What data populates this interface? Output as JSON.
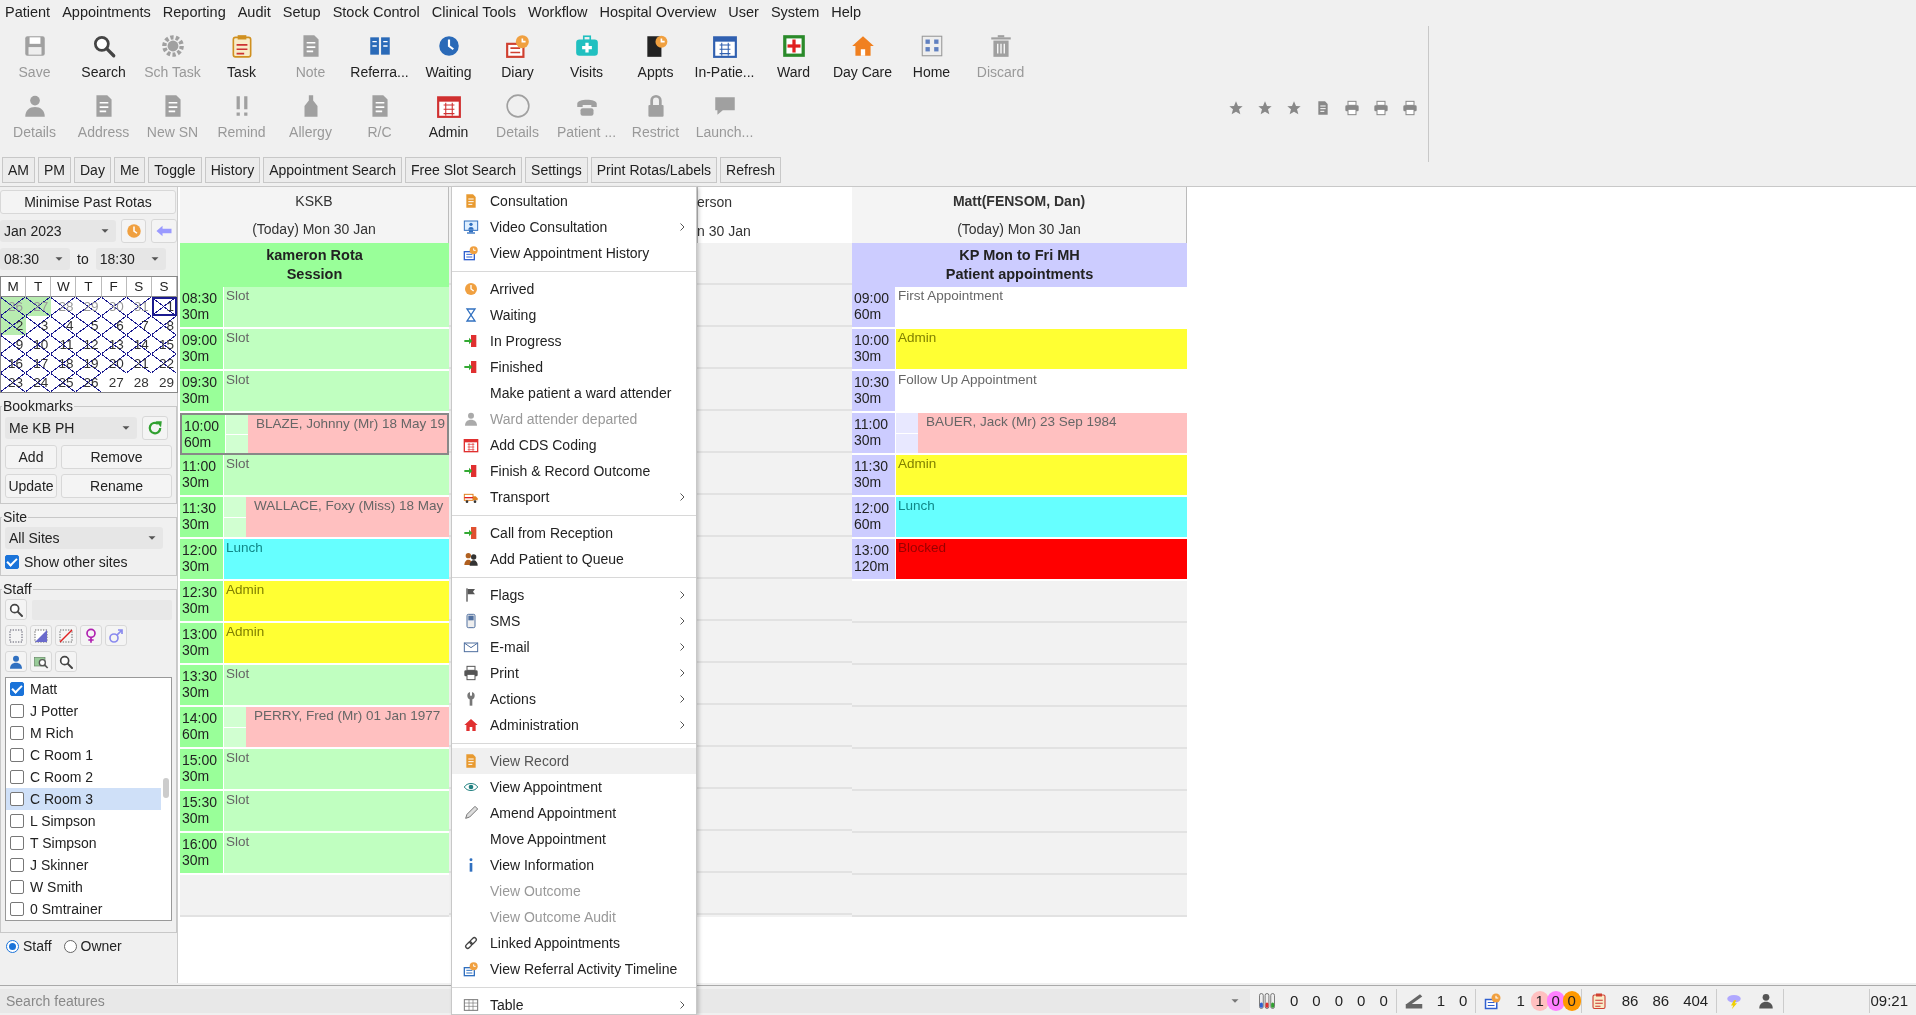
{
  "menu_bar": [
    "Patient",
    "Appointments",
    "Reporting",
    "Audit",
    "Setup",
    "Stock Control",
    "Clinical Tools",
    "Workflow",
    "Hospital Overview",
    "User",
    "System",
    "Help"
  ],
  "toolbar": {
    "rows": [
      [
        {
          "label": "Save",
          "disabled": true
        },
        {
          "label": "Search",
          "disabled": false
        },
        {
          "label": "Sch Task",
          "disabled": true
        },
        {
          "label": "Task",
          "disabled": false
        },
        {
          "label": "Note",
          "disabled": true
        },
        {
          "label": "Referra...",
          "disabled": false
        },
        {
          "label": "Waiting",
          "disabled": false
        },
        {
          "label": "Diary",
          "disabled": false
        },
        {
          "label": "Visits",
          "disabled": false
        },
        {
          "label": "Appts",
          "disabled": false
        },
        {
          "label": "In-Patie...",
          "disabled": false
        },
        {
          "label": "Ward",
          "disabled": false
        },
        {
          "label": "Day Care",
          "disabled": false
        },
        {
          "label": "Home",
          "disabled": false
        },
        {
          "label": "Discard",
          "disabled": true
        }
      ],
      [
        {
          "label": "Details",
          "disabled": true
        },
        {
          "label": "Address",
          "disabled": true
        },
        {
          "label": "New SN",
          "disabled": true
        },
        {
          "label": "Remind",
          "disabled": true
        },
        {
          "label": "Allergy",
          "disabled": true
        },
        {
          "label": "R/C",
          "disabled": true
        },
        {
          "label": "Admin",
          "disabled": false
        },
        {
          "label": "Details",
          "disabled": true
        },
        {
          "label": "Patient ...",
          "disabled": true
        },
        {
          "label": "Restrict",
          "disabled": true
        },
        {
          "label": "Launch...",
          "disabled": true
        }
      ]
    ]
  },
  "view_buttons": [
    "AM",
    "PM",
    "Day",
    "Me",
    "Toggle",
    "History",
    "Appointment Search",
    "Free Slot Search",
    "Settings",
    "Print Rotas/Labels",
    "Refresh"
  ],
  "left_panel": {
    "minimise_button": "Minimise Past Rotas",
    "month": "Jan 2023",
    "time_from": "08:30",
    "time_to_label": "to",
    "time_to": "18:30",
    "weekdays": [
      "M",
      "T",
      "W",
      "T",
      "F",
      "S",
      "S"
    ],
    "weeks": [
      [
        {
          "day": "26",
          "other_month": true,
          "crossed": true,
          "booked": true,
          "selected": false
        },
        {
          "day": "27",
          "other_month": true,
          "crossed": true,
          "booked": true,
          "selected": false
        },
        {
          "day": "28",
          "other_month": true,
          "crossed": true,
          "booked": false,
          "selected": false
        },
        {
          "day": "29",
          "other_month": true,
          "crossed": true,
          "booked": false,
          "selected": false
        },
        {
          "day": "30",
          "other_month": true,
          "crossed": true,
          "booked": false,
          "selected": false
        },
        {
          "day": "31",
          "other_month": true,
          "crossed": true,
          "booked": false,
          "selected": false
        },
        {
          "day": "1",
          "other_month": false,
          "crossed": true,
          "booked": false,
          "selected": true
        }
      ],
      [
        {
          "day": "2",
          "other_month": false,
          "crossed": true,
          "booked": true,
          "selected": false
        },
        {
          "day": "3",
          "other_month": false,
          "crossed": true,
          "booked": false,
          "selected": false
        },
        {
          "day": "4",
          "other_month": false,
          "crossed": true,
          "booked": false,
          "selected": false
        },
        {
          "day": "5",
          "other_month": false,
          "crossed": true,
          "booked": false,
          "selected": false
        },
        {
          "day": "6",
          "other_month": false,
          "crossed": true,
          "booked": false,
          "selected": false
        },
        {
          "day": "7",
          "other_month": false,
          "crossed": true,
          "booked": false,
          "selected": false
        },
        {
          "day": "8",
          "other_month": false,
          "crossed": true,
          "booked": false,
          "selected": false
        }
      ],
      [
        {
          "day": "9",
          "other_month": false,
          "crossed": true,
          "booked": false,
          "selected": false
        },
        {
          "day": "10",
          "other_month": false,
          "crossed": true,
          "booked": false,
          "selected": false
        },
        {
          "day": "11",
          "other_month": false,
          "crossed": true,
          "booked": false,
          "selected": false
        },
        {
          "day": "12",
          "other_month": false,
          "crossed": true,
          "booked": false,
          "selected": false
        },
        {
          "day": "13",
          "other_month": false,
          "crossed": true,
          "booked": false,
          "selected": false
        },
        {
          "day": "14",
          "other_month": false,
          "crossed": true,
          "booked": false,
          "selected": false
        },
        {
          "day": "15",
          "other_month": false,
          "crossed": true,
          "booked": false,
          "selected": false
        }
      ],
      [
        {
          "day": "16",
          "other_month": false,
          "crossed": true,
          "booked": false,
          "selected": false
        },
        {
          "day": "17",
          "other_month": false,
          "crossed": true,
          "booked": false,
          "selected": false
        },
        {
          "day": "18",
          "other_month": false,
          "crossed": true,
          "booked": false,
          "selected": false
        },
        {
          "day": "19",
          "other_month": false,
          "crossed": true,
          "booked": false,
          "selected": false
        },
        {
          "day": "20",
          "other_month": false,
          "crossed": true,
          "booked": false,
          "selected": false
        },
        {
          "day": "21",
          "other_month": false,
          "crossed": true,
          "booked": false,
          "selected": false
        },
        {
          "day": "22",
          "other_month": false,
          "crossed": true,
          "booked": false,
          "selected": false
        }
      ],
      [
        {
          "day": "23",
          "other_month": false,
          "crossed": true,
          "booked": false,
          "selected": false
        },
        {
          "day": "24",
          "other_month": false,
          "crossed": true,
          "booked": false,
          "selected": false
        },
        {
          "day": "25",
          "other_month": false,
          "crossed": true,
          "booked": false,
          "selected": false
        },
        {
          "day": "26",
          "other_month": false,
          "crossed": true,
          "booked": false,
          "selected": false
        },
        {
          "day": "27",
          "other_month": false,
          "crossed": false,
          "booked": false,
          "selected": false
        },
        {
          "day": "28",
          "other_month": false,
          "crossed": false,
          "booked": false,
          "selected": false
        },
        {
          "day": "29",
          "other_month": false,
          "crossed": false,
          "booked": false,
          "selected": false
        }
      ]
    ],
    "bookmarks": {
      "title": "Bookmarks",
      "value": "Me KB PH",
      "buttons": [
        "Add",
        "Remove",
        "Update",
        "Rename"
      ]
    },
    "site": {
      "title": "Site",
      "value": "All Sites",
      "checkbox": {
        "label": "Show other sites",
        "checked": true
      }
    },
    "staff": {
      "title": "Staff",
      "items": [
        {
          "name": "Matt",
          "checked": true,
          "selected": false
        },
        {
          "name": "J Potter",
          "checked": false,
          "selected": false
        },
        {
          "name": "M Rich",
          "checked": false,
          "selected": false
        },
        {
          "name": "C Room 1",
          "checked": false,
          "selected": false
        },
        {
          "name": "C Room 2",
          "checked": false,
          "selected": false
        },
        {
          "name": "C Room 3",
          "checked": false,
          "selected": true
        },
        {
          "name": "L Simpson",
          "checked": false,
          "selected": false
        },
        {
          "name": "T Simpson",
          "checked": false,
          "selected": false
        },
        {
          "name": "J Skinner",
          "checked": false,
          "selected": false
        },
        {
          "name": "W Smith",
          "checked": false,
          "selected": false
        },
        {
          "name": "0 Smtrainer",
          "checked": false,
          "selected": false
        }
      ]
    },
    "filter": [
      {
        "label": "Staff",
        "selected": true
      },
      {
        "label": "Owner",
        "selected": false
      }
    ]
  },
  "diary": {
    "columns": [
      {
        "kind": "rota",
        "name": "KSKB",
        "date": "(Today) Mon 30 Jan",
        "selected": false,
        "color": "#99ff99",
        "session": [
          "kameron Rota",
          "Session"
        ],
        "rows": [
          {
            "time": "08:30",
            "duration": "30m",
            "kind": "slot",
            "label": "Slot",
            "selected": false
          },
          {
            "time": "09:00",
            "duration": "30m",
            "kind": "slot",
            "label": "Slot",
            "selected": false
          },
          {
            "time": "09:30",
            "duration": "30m",
            "kind": "slot",
            "label": "Slot",
            "selected": false
          },
          {
            "time": "10:00",
            "duration": "60m",
            "kind": "booked",
            "label": "BLAZE, Johnny (Mr) 18 May 19",
            "selected": true
          },
          {
            "time": "11:00",
            "duration": "30m",
            "kind": "slot",
            "label": "Slot",
            "selected": false
          },
          {
            "time": "11:30",
            "duration": "30m",
            "kind": "booked",
            "label": "WALLACE, Foxy (Miss) 18 May",
            "selected": false
          },
          {
            "time": "12:00",
            "duration": "30m",
            "kind": "lunch",
            "label": "Lunch",
            "selected": false
          },
          {
            "time": "12:30",
            "duration": "30m",
            "kind": "admin",
            "label": "Admin",
            "selected": false
          },
          {
            "time": "13:00",
            "duration": "30m",
            "kind": "admin",
            "label": "Admin",
            "selected": false
          },
          {
            "time": "13:30",
            "duration": "30m",
            "kind": "slot",
            "label": "Slot",
            "selected": false
          },
          {
            "time": "14:00",
            "duration": "60m",
            "kind": "booked",
            "label": "PERRY, Fred (Mr) 01 Jan 1977",
            "selected": false
          },
          {
            "time": "15:00",
            "duration": "30m",
            "kind": "slot",
            "label": "Slot",
            "selected": false
          },
          {
            "time": "15:30",
            "duration": "30m",
            "kind": "slot",
            "label": "Slot",
            "selected": false
          },
          {
            "time": "16:00",
            "duration": "30m",
            "kind": "slot",
            "label": "Slot",
            "selected": false
          }
        ]
      },
      {
        "kind": "partial",
        "name": "erson",
        "date": "n 30 Jan",
        "selected": false
      },
      {
        "kind": "rota",
        "name": "Matt(FENSOM, Dan)",
        "date": "(Today) Mon 30 Jan",
        "selected": true,
        "color": "#ccccff",
        "session": [
          "KP Mon to Fri MH",
          "Patient appointments"
        ],
        "rows": [
          {
            "time": "09:00",
            "duration": "60m",
            "kind": "open",
            "label": "First Appointment",
            "selected": false
          },
          {
            "time": "10:00",
            "duration": "30m",
            "kind": "admin",
            "label": "Admin",
            "selected": false
          },
          {
            "time": "10:30",
            "duration": "30m",
            "kind": "open",
            "label": "Follow Up Appointment",
            "selected": false
          },
          {
            "time": "11:00",
            "duration": "30m",
            "kind": "booked",
            "label": "BAUER, Jack (Mr) 23 Sep 1984",
            "selected": false
          },
          {
            "time": "11:30",
            "duration": "30m",
            "kind": "admin",
            "label": "Admin",
            "selected": false
          },
          {
            "time": "12:00",
            "duration": "60m",
            "kind": "lunch",
            "label": "Lunch",
            "selected": false
          },
          {
            "time": "13:00",
            "duration": "120m",
            "kind": "blocked",
            "label": "Blocked",
            "selected": false
          }
        ]
      }
    ]
  },
  "context_menu": {
    "groups": [
      {
        "items": [
          {
            "label": "Consultation",
            "disabled": false,
            "submenu": false,
            "selected": false
          },
          {
            "label": "Video Consultation",
            "disabled": false,
            "submenu": true,
            "selected": false
          },
          {
            "label": "View Appointment History",
            "disabled": false,
            "submenu": false,
            "selected": false
          }
        ]
      },
      {
        "items": [
          {
            "label": "Arrived",
            "disabled": false,
            "submenu": false,
            "selected": false
          },
          {
            "label": "Waiting",
            "disabled": false,
            "submenu": false,
            "selected": false
          },
          {
            "label": "In Progress",
            "disabled": false,
            "submenu": false,
            "selected": false
          },
          {
            "label": "Finished",
            "disabled": false,
            "submenu": false,
            "selected": false
          },
          {
            "label": "Make patient a ward attender",
            "disabled": false,
            "submenu": false,
            "selected": false
          },
          {
            "label": "Ward attender departed",
            "disabled": true,
            "submenu": false,
            "selected": false
          },
          {
            "label": "Add CDS Coding",
            "disabled": false,
            "submenu": false,
            "selected": false
          },
          {
            "label": "Finish & Record Outcome",
            "disabled": false,
            "submenu": false,
            "selected": false
          },
          {
            "label": "Transport",
            "disabled": false,
            "submenu": true,
            "selected": false
          }
        ]
      },
      {
        "items": [
          {
            "label": "Call from Reception",
            "disabled": false,
            "submenu": false,
            "selected": false
          },
          {
            "label": "Add Patient to Queue",
            "disabled": false,
            "submenu": false,
            "selected": false
          }
        ]
      },
      {
        "items": [
          {
            "label": "Flags",
            "disabled": false,
            "submenu": true,
            "selected": false
          },
          {
            "label": "SMS",
            "disabled": false,
            "submenu": true,
            "selected": false
          },
          {
            "label": "E-mail",
            "disabled": false,
            "submenu": true,
            "selected": false
          },
          {
            "label": "Print",
            "disabled": false,
            "submenu": true,
            "selected": false
          },
          {
            "label": "Actions",
            "disabled": false,
            "submenu": true,
            "selected": false
          },
          {
            "label": "Administration",
            "disabled": false,
            "submenu": true,
            "selected": false
          }
        ]
      },
      {
        "items": [
          {
            "label": "View Record",
            "disabled": false,
            "submenu": false,
            "selected": true
          },
          {
            "label": "View Appointment",
            "disabled": false,
            "submenu": false,
            "selected": false
          },
          {
            "label": "Amend Appointment",
            "disabled": false,
            "submenu": false,
            "selected": false
          },
          {
            "label": "Move Appointment",
            "disabled": false,
            "submenu": false,
            "selected": false
          },
          {
            "label": "View Information",
            "disabled": false,
            "submenu": false,
            "selected": false
          },
          {
            "label": "View Outcome",
            "disabled": true,
            "submenu": false,
            "selected": false
          },
          {
            "label": "View Outcome Audit",
            "disabled": true,
            "submenu": false,
            "selected": false
          },
          {
            "label": "Linked Appointments",
            "disabled": false,
            "submenu": false,
            "selected": false
          },
          {
            "label": "View Referral Activity Timeline",
            "disabled": false,
            "submenu": false,
            "selected": false
          }
        ]
      },
      {
        "items": [
          {
            "label": "Table",
            "disabled": false,
            "submenu": true,
            "selected": false
          }
        ]
      }
    ]
  },
  "status_bar": {
    "search_placeholder": "Search features",
    "groups": [
      {
        "items": [
          {
            "text": "0"
          },
          {
            "text": "0"
          },
          {
            "text": "0"
          },
          {
            "text": "0"
          },
          {
            "text": "0"
          }
        ]
      },
      {
        "items": [
          {
            "text": "1"
          },
          {
            "text": "0"
          }
        ]
      },
      {
        "items": [
          {
            "text": "1"
          },
          {
            "text": "1",
            "color": "#ffc0c0"
          },
          {
            "text": "0",
            "color": "#ff80ff"
          },
          {
            "text": "0",
            "color": "#ff9900"
          }
        ]
      },
      {
        "items": [
          {
            "text": "86"
          },
          {
            "text": "86"
          },
          {
            "text": "404"
          }
        ]
      }
    ],
    "time": "09:21"
  }
}
